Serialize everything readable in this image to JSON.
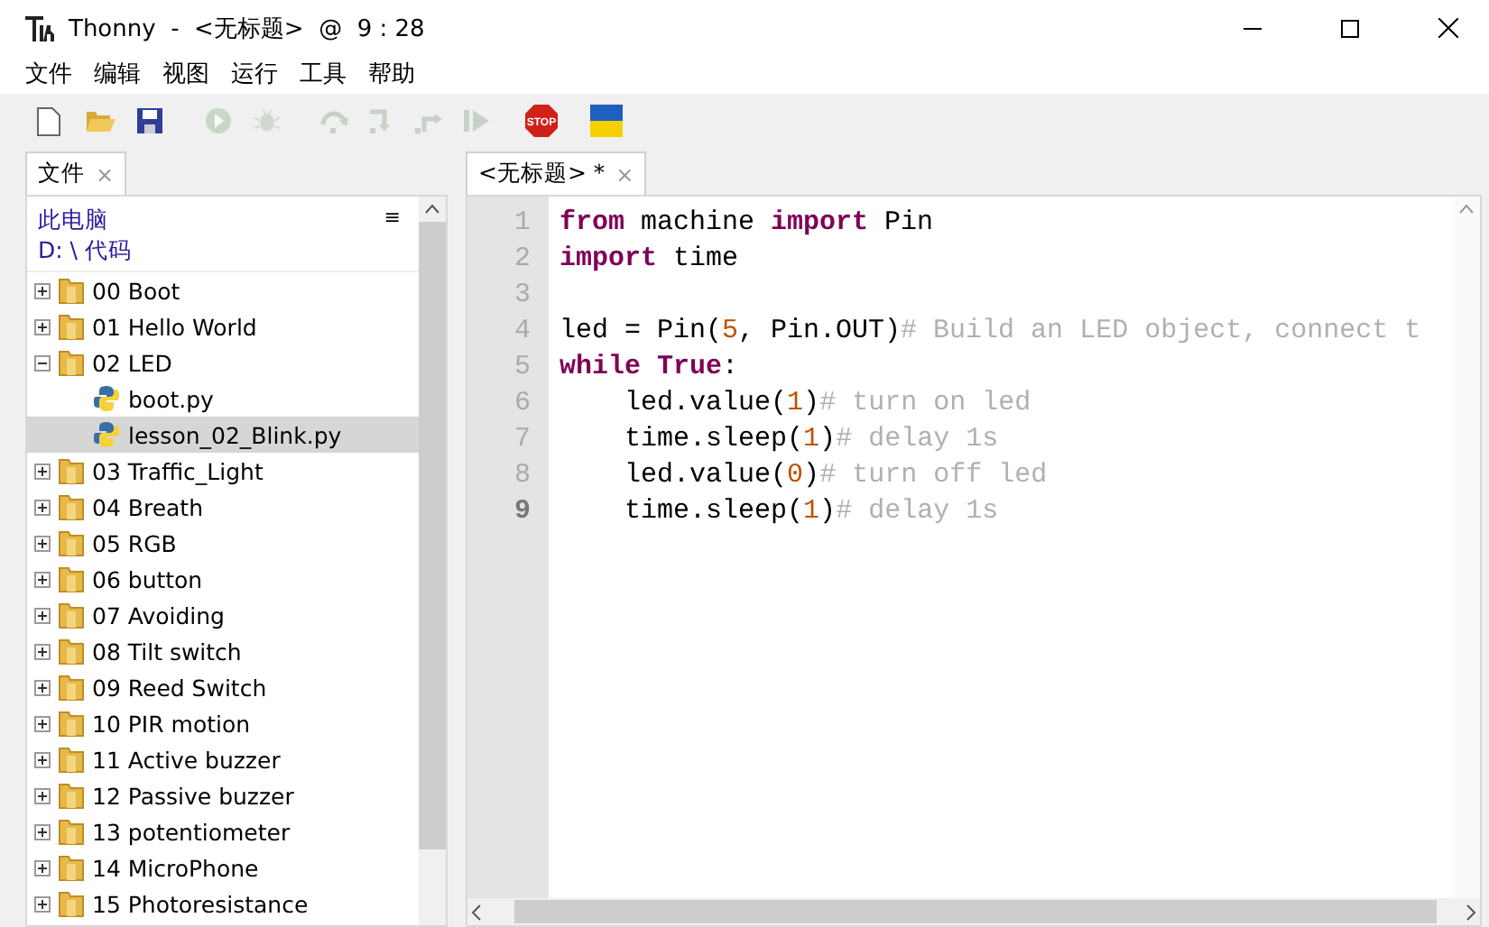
{
  "window": {
    "title": "Thonny  -  <无标题>  @  9 : 28"
  },
  "menu": [
    "文件",
    "编辑",
    "视图",
    "运行",
    "工具",
    "帮助"
  ],
  "toolbar": [
    {
      "kind": "new"
    },
    {
      "kind": "open"
    },
    {
      "kind": "save"
    },
    {
      "kind": "run",
      "disabled": true
    },
    {
      "kind": "debug",
      "disabled": true
    },
    {
      "kind": "step-over",
      "disabled": true
    },
    {
      "kind": "step-into",
      "disabled": true
    },
    {
      "kind": "step-out",
      "disabled": true
    },
    {
      "kind": "resume",
      "disabled": true
    },
    {
      "kind": "stop",
      "label": "STOP"
    },
    {
      "kind": "flag"
    }
  ],
  "files_panel": {
    "tab": {
      "label": "文件",
      "close": "×",
      "selected": true
    },
    "location": "此电脑",
    "path": "D: \\ 代码",
    "menu": "≡",
    "tree": [
      {
        "label": "00 Boot",
        "kind": "folder",
        "expanded": false,
        "selected": false
      },
      {
        "label": "01 Hello World",
        "kind": "folder",
        "expanded": false,
        "selected": false
      },
      {
        "label": "02 LED",
        "kind": "folder",
        "expanded": true,
        "selected": false,
        "children": [
          {
            "label": "boot.py",
            "kind": "file",
            "selected": false
          },
          {
            "label": "lesson_02_Blink.py",
            "kind": "file",
            "selected": true
          }
        ]
      },
      {
        "label": "03 Traffic_Light",
        "kind": "folder",
        "expanded": false,
        "selected": false
      },
      {
        "label": "04 Breath",
        "kind": "folder",
        "expanded": false,
        "selected": false
      },
      {
        "label": "05 RGB",
        "kind": "folder",
        "expanded": false,
        "selected": false
      },
      {
        "label": "06 button",
        "kind": "folder",
        "expanded": false,
        "selected": false
      },
      {
        "label": "07 Avoiding",
        "kind": "folder",
        "expanded": false,
        "selected": false
      },
      {
        "label": "08 Tilt switch",
        "kind": "folder",
        "expanded": false,
        "selected": false
      },
      {
        "label": "09 Reed Switch",
        "kind": "folder",
        "expanded": false,
        "selected": false
      },
      {
        "label": "10 PIR motion",
        "kind": "folder",
        "expanded": false,
        "selected": false
      },
      {
        "label": "11 Active buzzer",
        "kind": "folder",
        "expanded": false,
        "selected": false
      },
      {
        "label": "12 Passive buzzer",
        "kind": "folder",
        "expanded": false,
        "selected": false
      },
      {
        "label": "13 potentiometer",
        "kind": "folder",
        "expanded": false,
        "selected": false
      },
      {
        "label": "14 MicroPhone",
        "kind": "folder",
        "expanded": false,
        "selected": false
      },
      {
        "label": "15 Photoresistance",
        "kind": "folder",
        "expanded": false,
        "selected": false
      }
    ]
  },
  "editor": {
    "tab": {
      "label": "<无标题> *",
      "close": "×",
      "selected": true
    },
    "lines": [
      {
        "number": "1",
        "current": false,
        "tokens": [
          {
            "kind": "keyword",
            "text": "from"
          },
          {
            "kind": "plain",
            "text": " machine "
          },
          {
            "kind": "keyword",
            "text": "import"
          },
          {
            "kind": "plain",
            "text": " Pin"
          }
        ]
      },
      {
        "number": "2",
        "current": false,
        "tokens": [
          {
            "kind": "keyword",
            "text": "import"
          },
          {
            "kind": "plain",
            "text": " time"
          }
        ]
      },
      {
        "number": "3",
        "current": false
      },
      {
        "number": "4",
        "current": false,
        "tokens": [
          {
            "kind": "plain",
            "text": "led = Pin("
          },
          {
            "kind": "number",
            "text": "5"
          },
          {
            "kind": "plain",
            "text": ", Pin.OUT)"
          },
          {
            "kind": "comment",
            "text": "# Build an LED object, connect t"
          }
        ]
      },
      {
        "number": "5",
        "current": false,
        "tokens": [
          {
            "kind": "keyword",
            "text": "while"
          },
          {
            "kind": "keyword",
            "text": " True"
          },
          {
            "kind": "plain",
            "text": ":"
          }
        ]
      },
      {
        "number": "6",
        "current": false,
        "tokens": [
          {
            "kind": "plain",
            "text": "    led.value("
          },
          {
            "kind": "number",
            "text": "1"
          },
          {
            "kind": "plain",
            "text": ")"
          },
          {
            "kind": "comment",
            "text": "# turn on led"
          }
        ]
      },
      {
        "number": "7",
        "current": false,
        "tokens": [
          {
            "kind": "plain",
            "text": "    time.sleep("
          },
          {
            "kind": "number",
            "text": "1"
          },
          {
            "kind": "plain",
            "text": ")"
          },
          {
            "kind": "comment",
            "text": "# delay 1s"
          }
        ]
      },
      {
        "number": "8",
        "current": false,
        "tokens": [
          {
            "kind": "plain",
            "text": "    led.value("
          },
          {
            "kind": "number",
            "text": "0"
          },
          {
            "kind": "plain",
            "text": ")"
          },
          {
            "kind": "comment",
            "text": "# turn off led"
          }
        ]
      },
      {
        "number": "9",
        "current": true,
        "tokens": [
          {
            "kind": "plain",
            "text": "    time.sleep("
          },
          {
            "kind": "number",
            "text": "1"
          },
          {
            "kind": "plain",
            "text": ")"
          },
          {
            "kind": "comment",
            "text": "# delay 1s"
          }
        ]
      }
    ]
  }
}
